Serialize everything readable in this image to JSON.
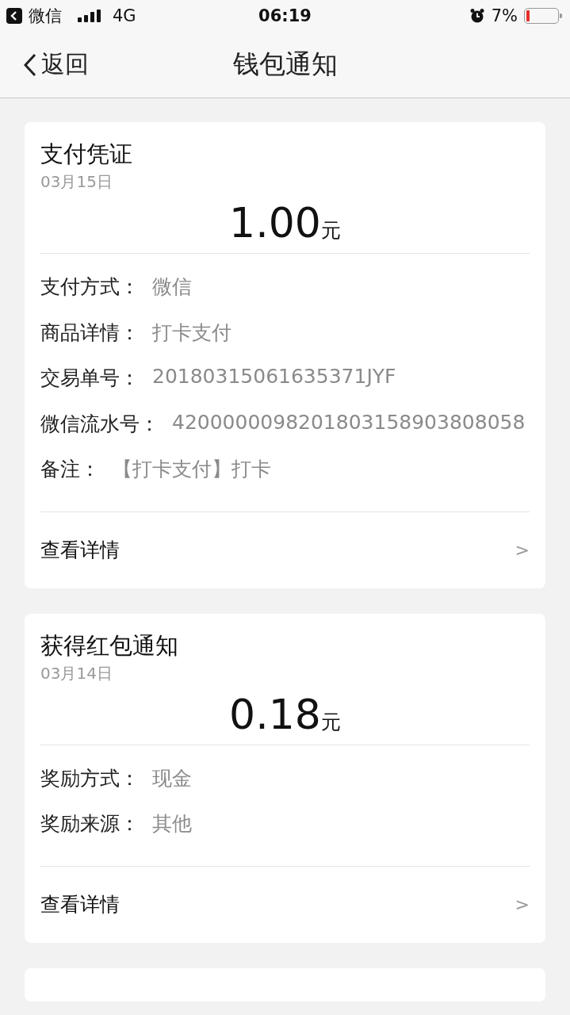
{
  "status_bar": {
    "back_app": "微信",
    "network": "4G",
    "time": "06:19",
    "battery": "7%"
  },
  "nav": {
    "back": "返回",
    "title": "钱包通知"
  },
  "cards": [
    {
      "title": "支付凭证",
      "date": "03月15日",
      "amount": "1.00",
      "unit": "元",
      "fields": [
        {
          "label": "支付方式：",
          "value": "微信"
        },
        {
          "label": "商品详情：",
          "value": "打卡支付"
        },
        {
          "label": "交易单号：",
          "value": "20180315061635371JYF"
        },
        {
          "label": "微信流水号：",
          "value": "4200000098201803158903808058"
        },
        {
          "label": "备注：",
          "value": "【打卡支付】打卡"
        }
      ],
      "link": "查看详情",
      "chevron": ">"
    },
    {
      "title": "获得红包通知",
      "date": "03月14日",
      "amount": "0.18",
      "unit": "元",
      "fields": [
        {
          "label": "奖励方式：",
          "value": "现金"
        },
        {
          "label": "奖励来源：",
          "value": "其他"
        }
      ],
      "link": "查看详情",
      "chevron": ">"
    }
  ]
}
